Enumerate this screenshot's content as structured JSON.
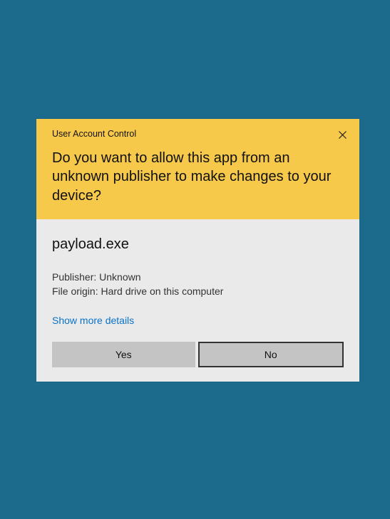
{
  "dialog": {
    "titlebar": "User Account Control",
    "heading": "Do you want to allow this app from an unknown publisher to make changes to your device?",
    "app_name": "payload.exe",
    "publisher_line": "Publisher: Unknown",
    "origin_line": "File origin: Hard drive on this computer",
    "details_link": "Show more details",
    "yes_label": "Yes",
    "no_label": "No"
  }
}
